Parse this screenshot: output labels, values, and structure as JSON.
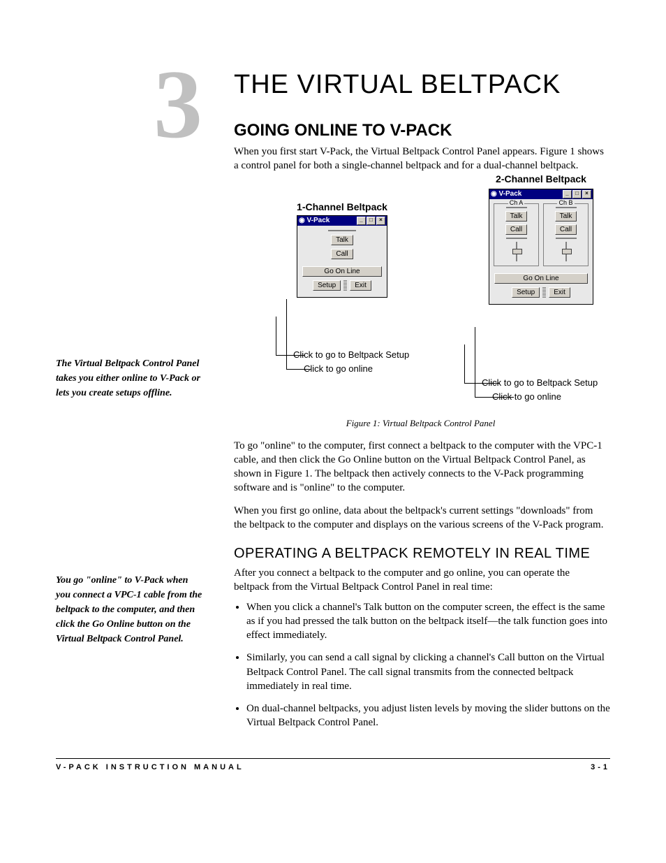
{
  "chapter": {
    "number": "3",
    "title": "THE VIRTUAL BELTPACK"
  },
  "section1": {
    "title": "GOING ONLINE TO V-PACK",
    "p1": "When you first start V-Pack, the Virtual Beltpack Control Panel appears. Figure 1 shows a control panel for both a single-channel beltpack and for a dual-channel beltpack."
  },
  "margin_notes": {
    "n1": "The Virtual Beltpack Control Panel takes you either online to V-Pack or lets you create setups offline.",
    "n2": "You go \"online\" to V-Pack when you connect a VPC-1 cable from the beltpack to the computer, and then click the Go Online button on the Virtual Beltpack Control Panel."
  },
  "figure": {
    "label1": "1-Channel Beltpack",
    "label2": "2-Channel Beltpack",
    "window_title": "V-Pack",
    "talk": "Talk",
    "call": "Call",
    "chA": "Ch A",
    "chB": "Ch B",
    "go_online": "Go On Line",
    "setup": "Setup",
    "exit": "Exit",
    "callout_setup": "Click to go to Beltpack Setup",
    "callout_online": "Click to go online",
    "caption": "Figure 1: Virtual Beltpack Control Panel"
  },
  "section1_cont": {
    "p2": "To go \"online\" to the computer, first connect a beltpack to the computer with the VPC-1 cable, and then click the Go Online button on the Virtual Beltpack Control Panel, as shown in Figure 1. The beltpack then actively connects to the V-Pack programming software and is \"online\" to the computer.",
    "p3": "When you first go online, data about the beltpack's current settings \"downloads\" from the beltpack to the computer and displays on the various screens of the V-Pack program."
  },
  "subsection": {
    "title": "OPERATING A BELTPACK REMOTELY IN REAL TIME",
    "intro": "After you connect a beltpack to the computer and go online, you can operate the beltpack from the Virtual Beltpack Control Panel in real time:",
    "bullets": [
      "When you click a channel's Talk button on the computer screen, the effect is the same as if you had pressed the talk button on the beltpack itself—the talk function goes into effect immediately.",
      "Similarly, you can send a call signal by clicking a channel's Call button on the Virtual Beltpack Control Panel. The call signal transmits from the connected beltpack immediately in real time.",
      "On dual-channel beltpacks, you adjust listen levels by moving the slider buttons on the Virtual Beltpack Control Panel."
    ]
  },
  "footer": {
    "left": "V-PACK INSTRUCTION MANUAL",
    "right": "3-1"
  }
}
